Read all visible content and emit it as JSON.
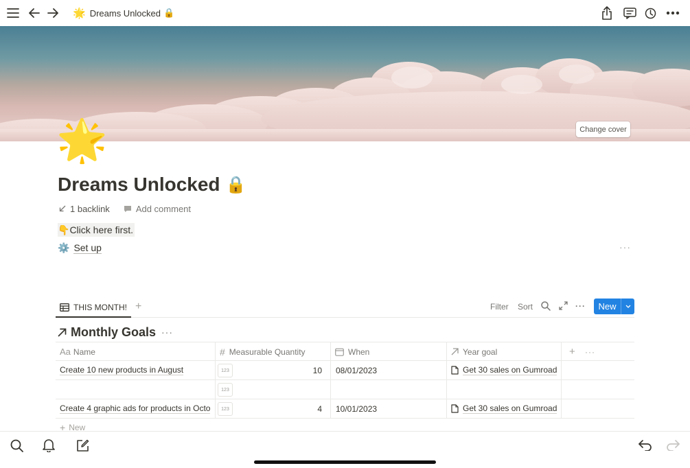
{
  "topbar": {
    "page_emoji": "🌟",
    "page_title": "Dreams Unlocked",
    "lock_emoji": "🔒",
    "icons": [
      "menu-icon",
      "back-arrow-icon",
      "forward-arrow-icon",
      "share-icon",
      "comments-icon",
      "history-icon",
      "more-icon"
    ]
  },
  "cover": {
    "change_cover_label": "Change cover"
  },
  "page": {
    "emoji": "🌟",
    "title": "Dreams Unlocked",
    "title_lock": "🔒",
    "backlink_label": "1 backlink",
    "add_comment_label": "Add comment",
    "click_here_emoji": "👇",
    "click_here_label": "Click here first.",
    "setup_emoji": "⚙️",
    "setup_label": "Set up",
    "block_menu": "···"
  },
  "database": {
    "view_tab_label": "THIS MONTH!",
    "add_view_label": "+",
    "filter_label": "Filter",
    "sort_label": "Sort",
    "more_label": "···",
    "new_label": "New",
    "title": "Monthly Goals",
    "title_menu": "···",
    "columns": [
      {
        "label": "Name",
        "icon": "Aa"
      },
      {
        "label": "Measurable Quantity",
        "icon": "#"
      },
      {
        "label": "When",
        "icon": "calendar-icon"
      },
      {
        "label": "Year goal",
        "icon": "relation-arrow-icon"
      }
    ],
    "add_column_label": "+",
    "column_menu_label": "···",
    "number_badge": "123",
    "rows": [
      {
        "name": "Create 10 new products in August",
        "quantity": "10",
        "when": "08/01/2023",
        "year_goal": "Get 30 sales on Gumroad"
      },
      {
        "name": "",
        "quantity": "",
        "when": "",
        "year_goal": ""
      },
      {
        "name": "Create 4 graphic ads for products in Octo",
        "quantity": "4",
        "when": "10/01/2023",
        "year_goal": "Get 30 sales on Gumroad"
      }
    ],
    "new_row_label": "New"
  },
  "bottombar": {
    "icons": [
      "search-icon",
      "notifications-bell-icon",
      "compose-icon",
      "undo-icon",
      "redo-icon"
    ]
  },
  "colors": {
    "accent": "#2383e2",
    "text": "#37352f",
    "muted": "#787774",
    "divider": "#e9e9e7"
  }
}
